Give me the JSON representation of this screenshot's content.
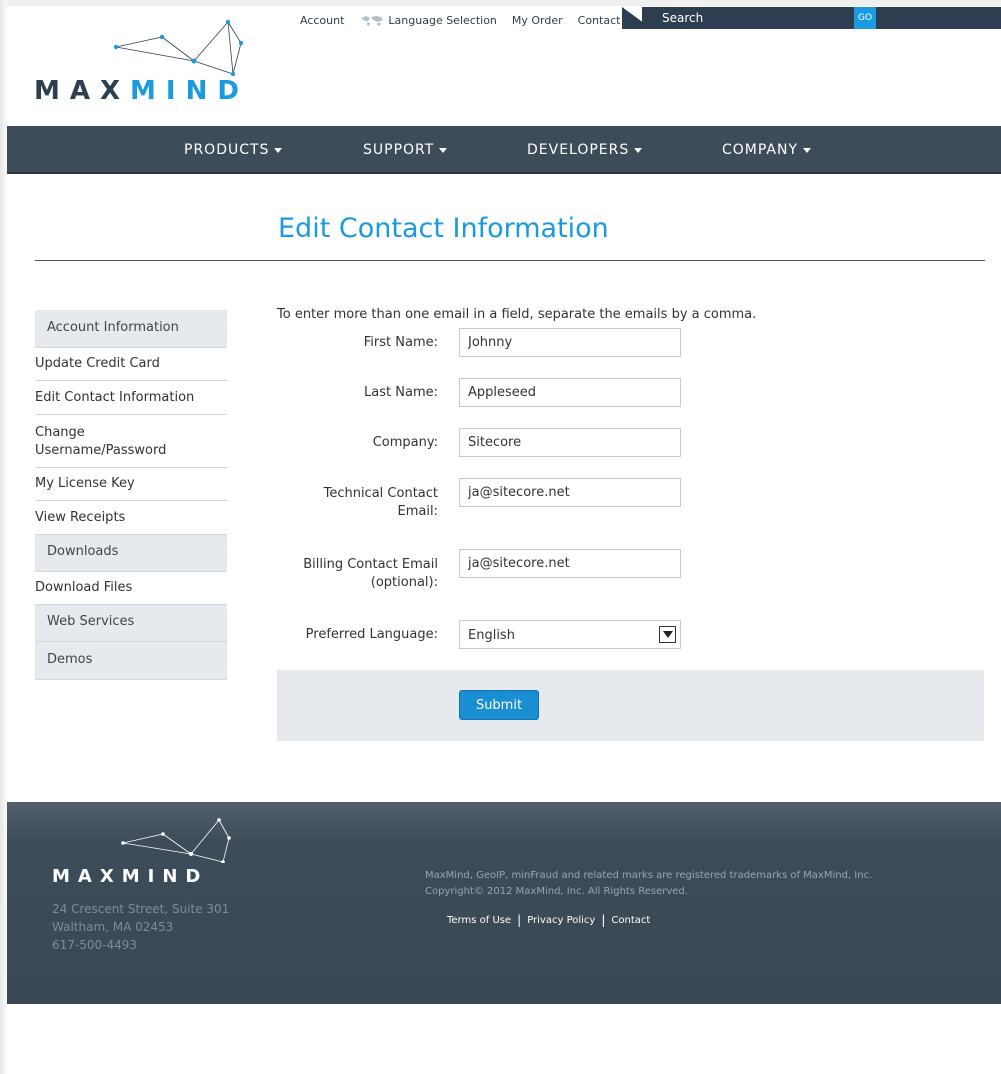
{
  "header": {
    "logo_text_a": "MAX",
    "logo_text_b": "MIND",
    "util_nav": {
      "account": "Account",
      "language": "Language Selection",
      "my_order": "My Order",
      "contact": "Contact"
    },
    "search": {
      "placeholder": "Search",
      "go_label": "GO"
    }
  },
  "main_nav": [
    {
      "label": "PRODUCTS"
    },
    {
      "label": "SUPPORT"
    },
    {
      "label": "DEVELOPERS"
    },
    {
      "label": "COMPANY"
    }
  ],
  "page_title": "Edit Contact Information",
  "sidebar": [
    {
      "label": "Account Information",
      "kind": "section"
    },
    {
      "label": "Update Credit Card",
      "kind": "link"
    },
    {
      "label": "Edit Contact Information",
      "kind": "link"
    },
    {
      "label": "Change Username/Password",
      "kind": "link"
    },
    {
      "label": "My License Key",
      "kind": "link"
    },
    {
      "label": "View Receipts",
      "kind": "link"
    },
    {
      "label": "Downloads",
      "kind": "section"
    },
    {
      "label": "Download Files",
      "kind": "link"
    },
    {
      "label": "Web Services",
      "kind": "section"
    },
    {
      "label": "Demos",
      "kind": "section"
    }
  ],
  "form": {
    "intro": "To enter more than one email in a field, separate the emails by a comma.",
    "first_name": {
      "label": "First Name:",
      "value": "Johnny"
    },
    "last_name": {
      "label": "Last Name:",
      "value": "Appleseed"
    },
    "company": {
      "label": "Company:",
      "value": "Sitecore"
    },
    "tech_email": {
      "label_1": "Technical Contact",
      "label_2": "Email:",
      "value": "ja@sitecore.net"
    },
    "billing_email": {
      "label_1": "Billing Contact Email",
      "label_2": "(optional):",
      "value": "ja@sitecore.net"
    },
    "language": {
      "label": "Preferred Language:",
      "value": "English"
    },
    "submit_label": "Submit"
  },
  "footer": {
    "logo_text": "MAXMIND",
    "address_1": "24 Crescent Street, Suite 301",
    "address_2": "Waltham, MA 02453",
    "phone": "617-500-4493",
    "legal_1": "MaxMind, GeoIP, minFraud and related marks are registered trademarks of MaxMind, Inc.",
    "legal_2": "Copyright© 2012 MaxMind, Inc. All Rights Reserved.",
    "links": {
      "terms": "Terms of Use",
      "privacy": "Privacy Policy",
      "contact": "Contact"
    },
    "separator": "|"
  },
  "colors": {
    "accent": "#1a9be0",
    "nav_bg": "#3d4c58",
    "panel_bg": "#e6eaee"
  }
}
